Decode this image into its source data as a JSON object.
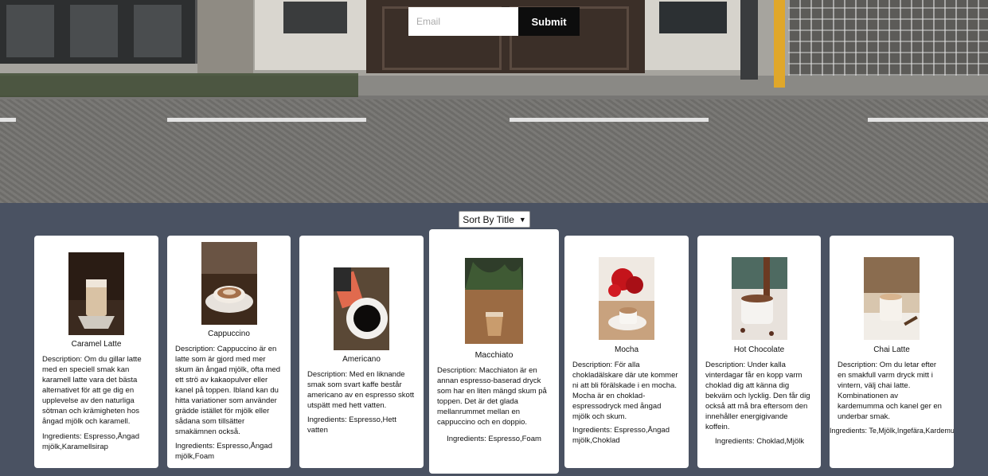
{
  "signup": {
    "email_placeholder": "Email",
    "submit_label": "Submit"
  },
  "sort": {
    "selected": "Sort By Title"
  },
  "cards": [
    {
      "title": "Caramel Latte",
      "description": "Description: Om du gillar latte med en speciell smak kan karamell latte vara det bästa alternativet för att ge dig en upplevelse av den naturliga sötman och krämigheten hos ångad mjölk och karamell.",
      "ingredients": "Ingredients: Espresso,Ångad mjölk,Karamellsirap"
    },
    {
      "title": "Cappuccino",
      "description": "Description: Cappuccino är en latte som är gjord med mer skum än ångad mjölk, ofta med ett strö av kakaopulver eller kanel på toppen. Ibland kan du hitta variationer som använder grädde istället för mjölk eller sådana som tillsätter smakämnen också.",
      "ingredients": "Ingredients: Espresso,Ångad mjölk,Foam"
    },
    {
      "title": "Americano",
      "description": "Description: Med en liknande smak som svart kaffe består americano av en espresso skott utspätt med hett vatten.",
      "ingredients": "Ingredients: Espresso,Hett vatten"
    },
    {
      "title": "Macchiato",
      "description": "Description: Macchiaton är en annan espresso-baserad dryck som har en liten mängd skum på toppen. Det är det glada mellanrummet mellan en cappuccino och en doppio.",
      "ingredients": "Ingredients: Espresso,Foam"
    },
    {
      "title": "Mocha",
      "description": "Description: För alla chokladälskare där ute kommer ni att bli förälskade i en mocha. Mocha är en choklad-espressodryck med ångad mjölk och skum.",
      "ingredients": "Ingredients: Espresso,Ångad mjölk,Choklad"
    },
    {
      "title": "Hot Chocolate",
      "description": "Description: Under kalla vinterdagar får en kopp varm choklad dig att känna dig bekväm och lycklig. Den får dig också att må bra eftersom den innehåller energigivande koffein.",
      "ingredients": "Ingredients: Choklad,Mjölk"
    },
    {
      "title": "Chai Latte",
      "description": "Description: Om du letar efter en smakfull varm dryck mitt i vintern, välj chai latte. Kombinationen av kardemumma och kanel ger en underbar smak.",
      "ingredients": "Ingredients: Te,Mjölk,Ingefära,Kardemumma,Kanel"
    }
  ]
}
